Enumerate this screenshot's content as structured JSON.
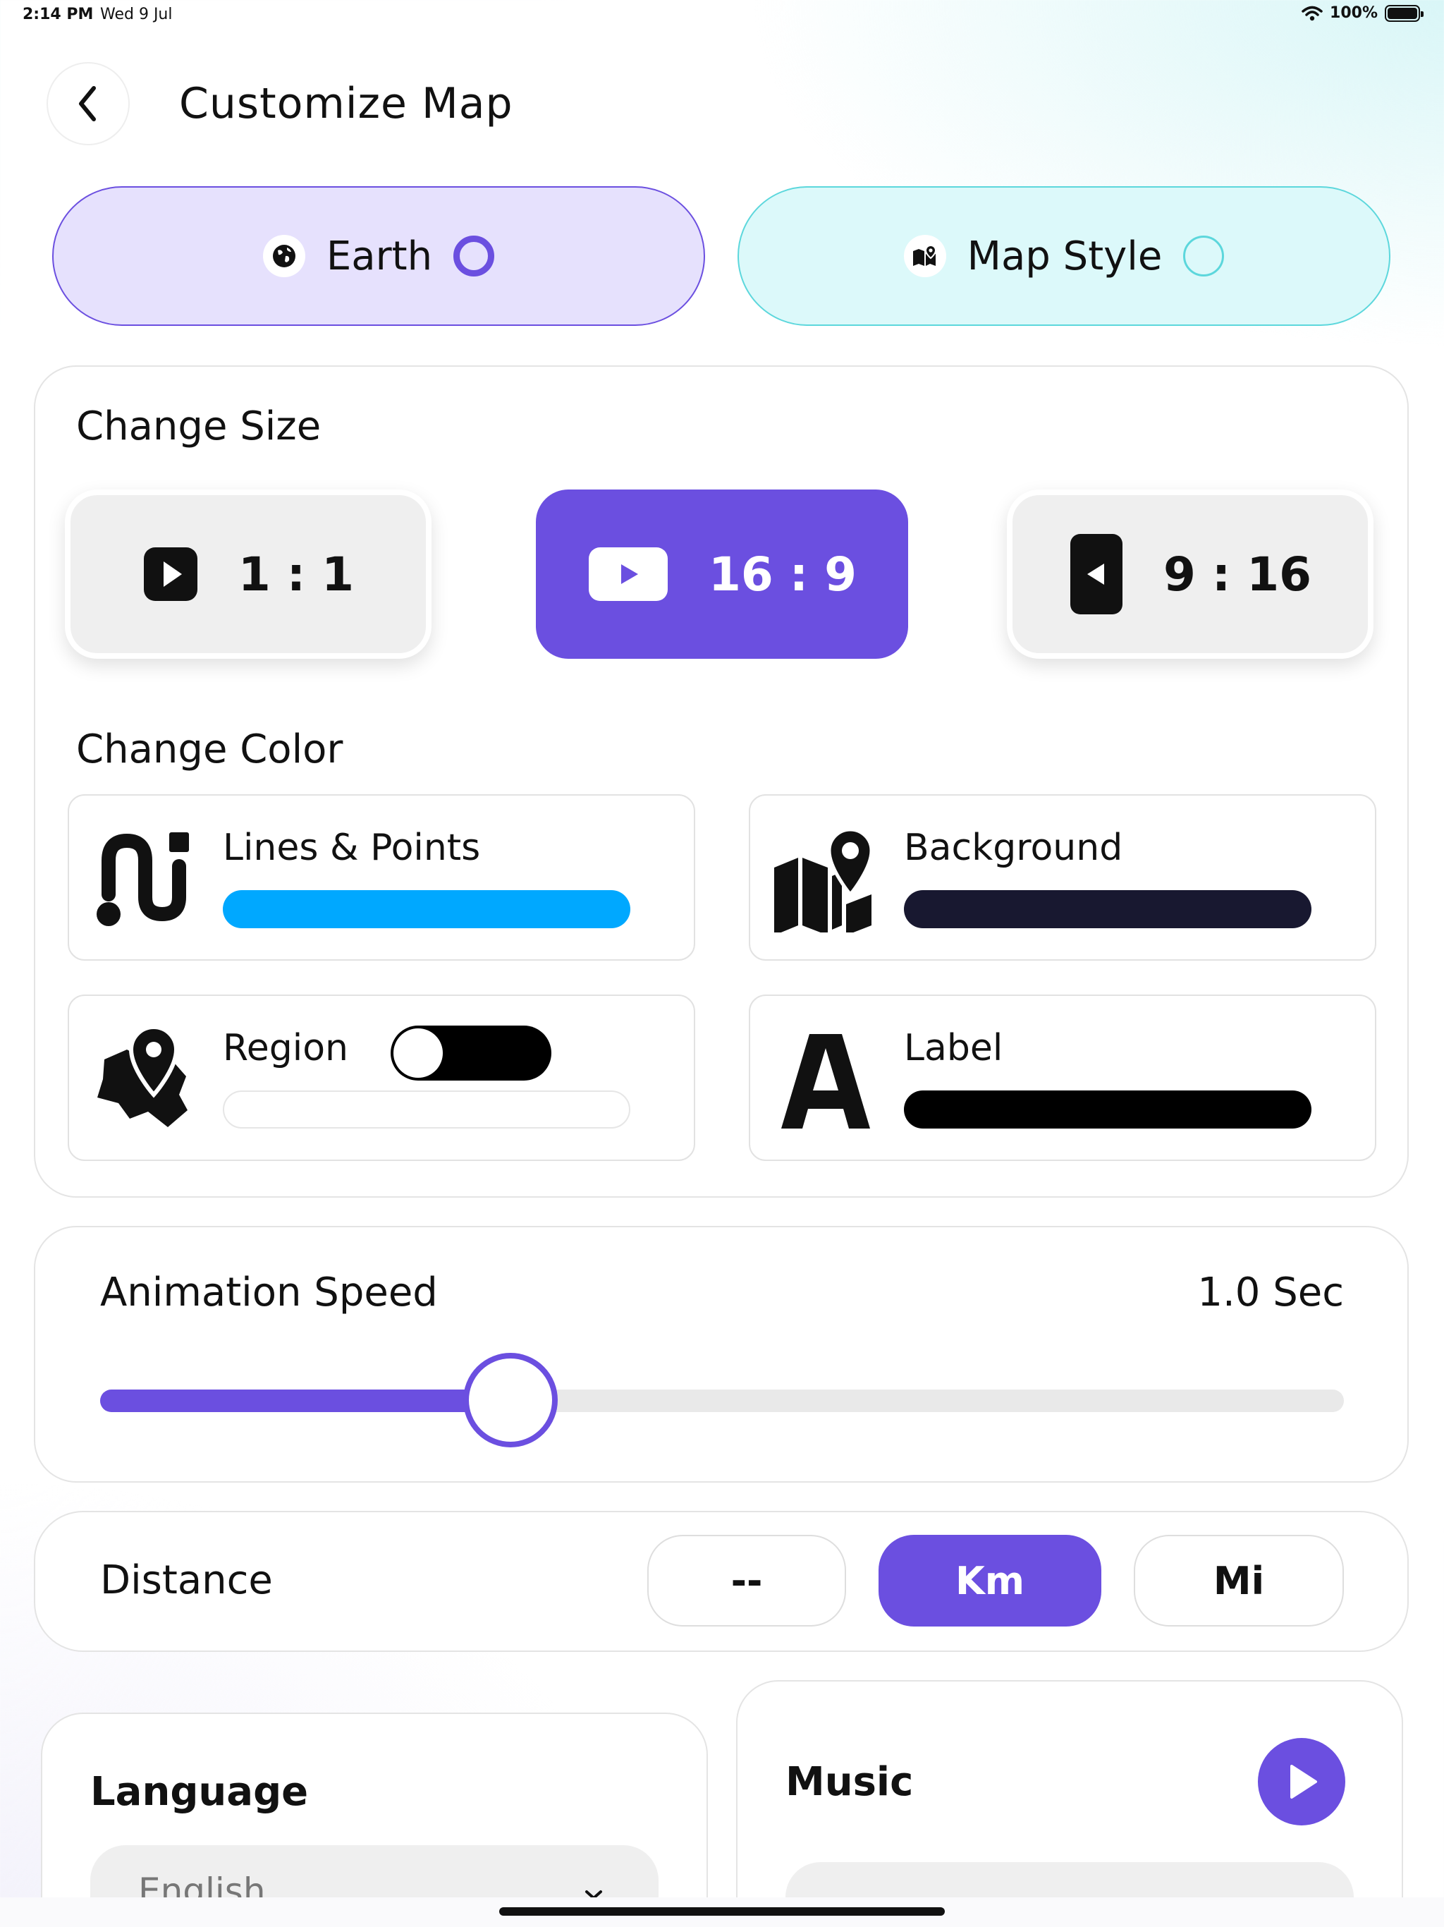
{
  "status_bar": {
    "time": "2:14 PM",
    "date": "Wed 9 Jul",
    "battery": "100%"
  },
  "header": {
    "title": "Customize Map",
    "back_icon": "chevron-left-icon"
  },
  "mode_tabs": [
    {
      "label": "Earth",
      "icon": "globe-icon",
      "selected": true
    },
    {
      "label": "Map Style",
      "icon": "map-pin-icon",
      "selected": false
    }
  ],
  "change_size": {
    "title": "Change Size",
    "options": [
      {
        "label": "1 : 1",
        "icon": "square-play-icon",
        "selected": false
      },
      {
        "label": "16 : 9",
        "icon": "landscape-play-icon",
        "selected": true
      },
      {
        "label": "9 : 16",
        "icon": "portrait-play-icon",
        "selected": false
      }
    ]
  },
  "change_color": {
    "title": "Change Color",
    "items": [
      {
        "label": "Lines & Points",
        "icon": "route-icon",
        "color": "#00a8ff"
      },
      {
        "label": "Background",
        "icon": "map-location-icon",
        "color": "#181830"
      },
      {
        "label": "Region",
        "icon": "region-pin-icon",
        "color": "#ffffff",
        "toggle_on": false
      },
      {
        "label": "Label",
        "icon": "letter-a-icon",
        "color": "#000000"
      }
    ]
  },
  "animation_speed": {
    "title": "Animation Speed",
    "value": "1.0 Sec",
    "slider_fraction": 0.33
  },
  "distance": {
    "title": "Distance",
    "options": [
      {
        "label": "--",
        "selected": false
      },
      {
        "label": "Km",
        "selected": true
      },
      {
        "label": "Mi",
        "selected": false
      }
    ]
  },
  "language": {
    "title": "Language",
    "selected": "English"
  },
  "music": {
    "title": "Music",
    "play_icon": "play-icon"
  },
  "colors": {
    "accent": "#6b4fe0",
    "teal": "#5cd7dc"
  }
}
